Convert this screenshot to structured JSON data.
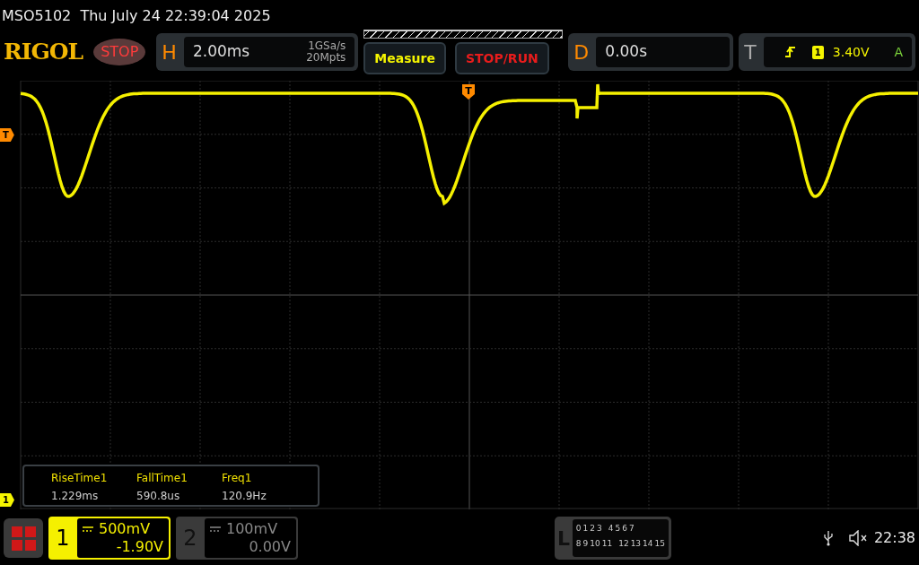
{
  "status_line": "MSO5102  Thu July 24 22:39:04 2025",
  "logo": "RIGOL",
  "run_state": "STOP",
  "horizontal": {
    "label": "H",
    "timebase": "2.00ms",
    "sample_rate": "1GSa/s",
    "memory_depth": "20Mpts"
  },
  "buttons": [
    {
      "label": "Measure",
      "kind": "measure"
    },
    {
      "label": "STOP/RUN",
      "kind": "run"
    }
  ],
  "delay": {
    "label": "D",
    "value": "0.00s"
  },
  "trigger": {
    "label": "T",
    "source": "1",
    "level": "3.40V",
    "mode": "A"
  },
  "markers": {
    "trigger_position": "T",
    "trigger_level": "T",
    "channel": "1"
  },
  "measurements": [
    {
      "label": "RiseTime1",
      "value": "1.229ms"
    },
    {
      "label": "FallTime1",
      "value": "590.8us"
    },
    {
      "label": "Freq1",
      "value": "120.9Hz"
    }
  ],
  "channels": [
    {
      "number": "1",
      "scale": "500mV",
      "offset": "-1.90V",
      "selected": true
    },
    {
      "number": "2",
      "scale": "100mV",
      "offset": "0.00V",
      "selected": false
    }
  ],
  "logic": {
    "label": "L",
    "row_1": [
      "0",
      "1",
      "2",
      "3",
      "4",
      "5",
      "6",
      "7"
    ],
    "row_2": [
      "8",
      "9",
      "10",
      "11",
      "12",
      "13",
      "14",
      "15"
    ]
  },
  "status_bar": {
    "time": "22:38"
  }
}
